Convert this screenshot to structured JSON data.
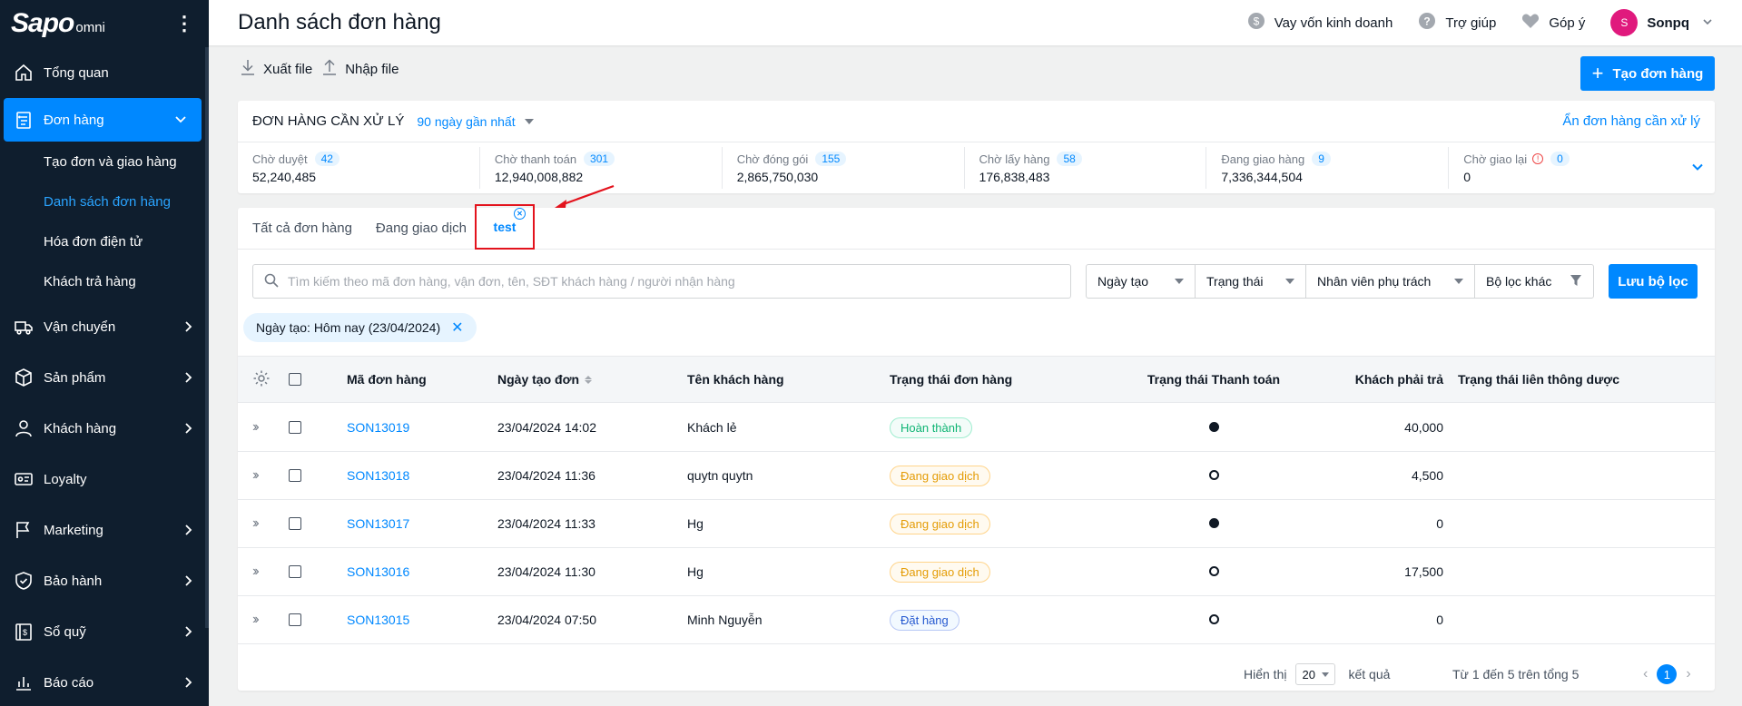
{
  "sidebar": {
    "logo_brand": "Sapo",
    "logo_sub": "omni",
    "items": [
      {
        "label": "Tổng quan",
        "icon": "home-icon"
      },
      {
        "label": "Đơn hàng",
        "icon": "orders-icon"
      },
      {
        "label": "Vận chuyển",
        "icon": "truck-icon"
      },
      {
        "label": "Sản phẩm",
        "icon": "box-icon"
      },
      {
        "label": "Khách hàng",
        "icon": "user-icon"
      },
      {
        "label": "Loyalty",
        "icon": "loyalty-card-icon"
      },
      {
        "label": "Marketing",
        "icon": "flag-icon"
      },
      {
        "label": "Bảo hành",
        "icon": "shield-icon"
      },
      {
        "label": "Sổ quỹ",
        "icon": "cashbook-icon"
      },
      {
        "label": "Báo cáo",
        "icon": "report-icon"
      }
    ],
    "sub_items": [
      {
        "label": "Tạo đơn và giao hàng"
      },
      {
        "label": "Danh sách đơn hàng"
      },
      {
        "label": "Hóa đơn điện tử"
      },
      {
        "label": "Khách trả hàng"
      }
    ]
  },
  "header": {
    "title": "Danh sách đơn hàng",
    "loan": "Vay vốn kinh doanh",
    "help": "Trợ giúp",
    "feedback": "Góp ý",
    "avatar_letter": "S",
    "user": "Sonpq"
  },
  "toolbar": {
    "export": "Xuất file",
    "import": "Nhập file",
    "create": "Tạo đơn hàng"
  },
  "pending": {
    "title": "ĐƠN HÀNG CẦN XỬ LÝ",
    "range": "90 ngày gần nhất",
    "hide": "Ẩn đơn hàng cần xử lý",
    "stats": [
      {
        "label": "Chờ duyệt",
        "count": "42",
        "value": "52,240,485"
      },
      {
        "label": "Chờ thanh toán",
        "count": "301",
        "value": "12,940,008,882"
      },
      {
        "label": "Chờ đóng gói",
        "count": "155",
        "value": "2,865,750,030"
      },
      {
        "label": "Chờ lấy hàng",
        "count": "58",
        "value": "176,838,483"
      },
      {
        "label": "Đang giao hàng",
        "count": "9",
        "value": "7,336,344,504"
      },
      {
        "label": "Chờ giao lại",
        "count": "0",
        "value": "0"
      }
    ]
  },
  "tabs": {
    "all": "Tất cả đơn hàng",
    "trading": "Đang giao dịch",
    "test": "test"
  },
  "filters": {
    "search_placeholder": "Tìm kiếm theo mã đơn hàng, vận đơn, tên, SĐT khách hàng / người nhận hàng",
    "created": "Ngày tạo",
    "status": "Trạng thái",
    "staff": "Nhân viên phụ trách",
    "other": "Bộ lọc khác",
    "save": "Lưu bộ lọc",
    "chip": "Ngày tạo: Hôm nay (23/04/2024)"
  },
  "table": {
    "headers": {
      "code": "Mã đơn hàng",
      "date": "Ngày tạo đơn",
      "customer": "Tên khách hàng",
      "status": "Trạng thái đơn hàng",
      "payment": "Trạng thái Thanh toán",
      "amount": "Khách phải trả",
      "link": "Trạng thái liên thông dược"
    },
    "rows": [
      {
        "code": "SON13019",
        "date": "23/04/2024 14:02",
        "customer": "Khách lẻ",
        "status": "Hoàn thành",
        "status_color": "green",
        "paid": true,
        "amount": "40,000"
      },
      {
        "code": "SON13018",
        "date": "23/04/2024 11:36",
        "customer": "quytn quytn",
        "status": "Đang giao dịch",
        "status_color": "orange",
        "paid": false,
        "amount": "4,500"
      },
      {
        "code": "SON13017",
        "date": "23/04/2024 11:33",
        "customer": "Hg",
        "status": "Đang giao dịch",
        "status_color": "orange",
        "paid": true,
        "amount": "0"
      },
      {
        "code": "SON13016",
        "date": "23/04/2024 11:30",
        "customer": "Hg",
        "status": "Đang giao dịch",
        "status_color": "orange",
        "paid": false,
        "amount": "17,500"
      },
      {
        "code": "SON13015",
        "date": "23/04/2024 07:50",
        "customer": "Minh Nguyễn",
        "status": "Đặt hàng",
        "status_color": "blue",
        "paid": false,
        "amount": "0"
      }
    ]
  },
  "pager": {
    "show": "Hiển thị",
    "per_page": "20",
    "result": "kết quả",
    "range": "Từ 1 đến 5 trên tổng 5",
    "page": "1"
  },
  "colors": {
    "accent": "#0088ff",
    "sidebar_bg": "#0f1e2e",
    "highlight": "#e3131d"
  }
}
